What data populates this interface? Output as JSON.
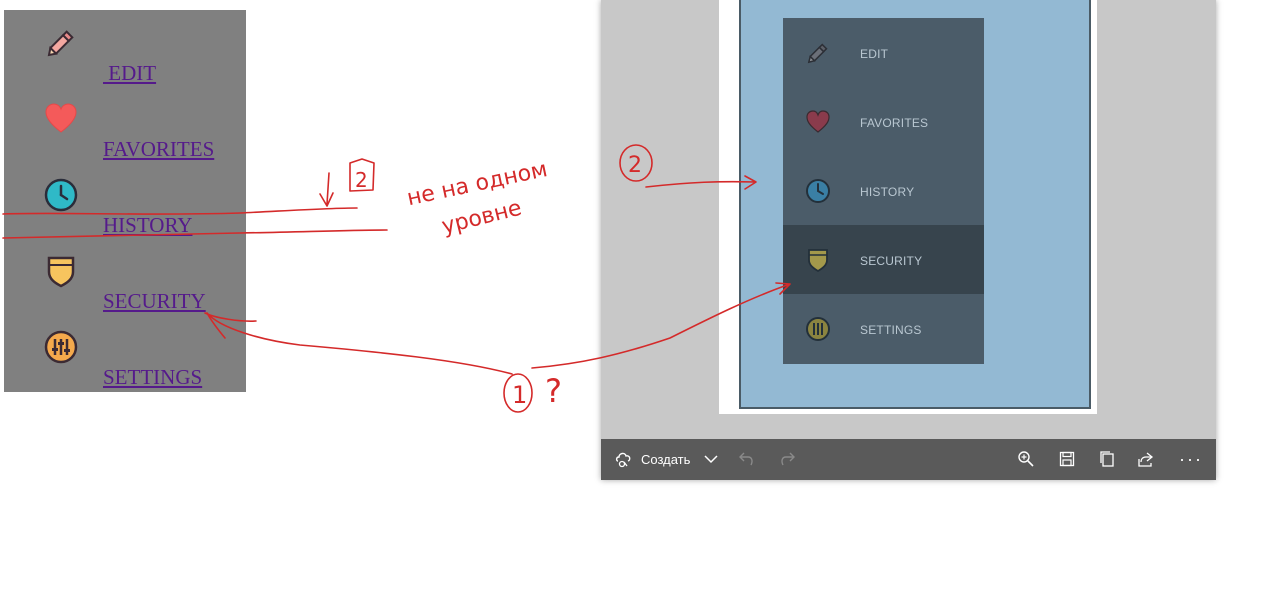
{
  "left_menu": {
    "items": [
      {
        "label": " EDIT",
        "icon": "pencil-icon"
      },
      {
        "label": "FAVORITES",
        "icon": "heart-icon"
      },
      {
        "label": "HISTORY",
        "icon": "clock-icon"
      },
      {
        "label": "SECURITY",
        "icon": "shield-icon"
      },
      {
        "label": "SETTINGS",
        "icon": "sliders-icon"
      }
    ],
    "background": "#808080",
    "link_color": "#551a8b"
  },
  "reference_menu": {
    "items": [
      {
        "label": "EDIT",
        "icon": "pencil-icon",
        "active": false
      },
      {
        "label": "FAVORITES",
        "icon": "heart-icon",
        "active": false
      },
      {
        "label": "HISTORY",
        "icon": "clock-icon",
        "active": false
      },
      {
        "label": "SECURITY",
        "icon": "shield-icon",
        "active": true
      },
      {
        "label": "SETTINGS",
        "icon": "sliders-icon",
        "active": false
      }
    ],
    "background": "#4b5c69",
    "active_background": "#37444d",
    "page_background": "#93b9d3"
  },
  "viewer_toolbar": {
    "create_label": "Создать",
    "buttons": [
      "create-icon",
      "chevron-down-icon",
      "undo-icon",
      "redo-icon",
      "zoom-in-icon",
      "save-icon",
      "copy-icon",
      "share-icon",
      "more-icon"
    ],
    "more_label": "···"
  },
  "annotations": {
    "note_line1": "не на одном",
    "note_line2": "уровне",
    "marker_1": "1",
    "marker_2": "2",
    "marker_2_box": "2",
    "question": "?",
    "color": "#d42a2a"
  }
}
